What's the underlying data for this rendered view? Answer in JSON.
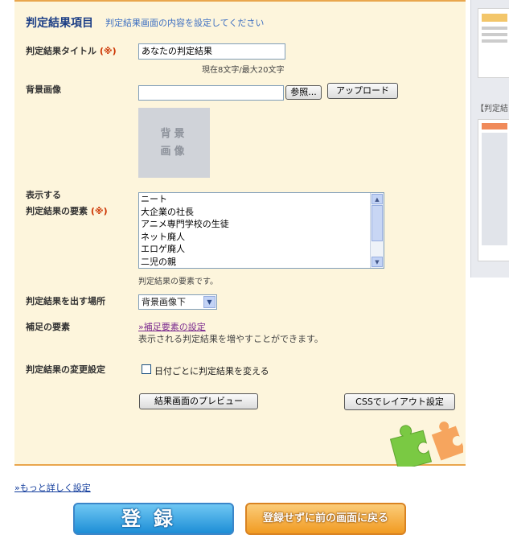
{
  "section": {
    "title": "判定結果項目",
    "subtitle": "判定結果画面の内容を設定してください"
  },
  "required_mark": "(※)",
  "result_title": {
    "label": "判定結果タイトル",
    "value": "あなたの判定結果",
    "counter": "現在8文字/最大20文字"
  },
  "bg_image": {
    "label": "背景画像",
    "file_value": "",
    "browse": "参照...",
    "upload": "アップロード",
    "placeholder_line1": "背景",
    "placeholder_line2": "画像"
  },
  "elements": {
    "label_line1": "表示する",
    "label_line2": "判定結果の要素",
    "items": [
      "ニート",
      "大企業の社長",
      "アニメ専門学校の生徒",
      "ネット廃人",
      "エロゲ廃人",
      "二児の親"
    ],
    "note": "判定結果の要素です。"
  },
  "position": {
    "label": "判定結果を出す場所",
    "selected": "背景画像下"
  },
  "supplement": {
    "label": "補足の要素",
    "link": "»補足要素の設定",
    "note": "表示される判定結果を増やすことができます。"
  },
  "change": {
    "label": "判定結果の変更設定",
    "checkbox_label": "日付ごとに判定結果を変える"
  },
  "buttons": {
    "preview": "結果画面のプレビュー",
    "css": "CSSでレイアウト設定"
  },
  "right_col": {
    "caption": "【判定結"
  },
  "footer": {
    "more_link": "»もっと詳しく設定",
    "register": "登録",
    "back": "登録せずに前の画面に戻る"
  },
  "colors": {
    "panel_bg": "#fdf5dc",
    "accent_orange": "#e9a64d",
    "title_blue": "#1d3f86",
    "required_red": "#cc3300"
  }
}
